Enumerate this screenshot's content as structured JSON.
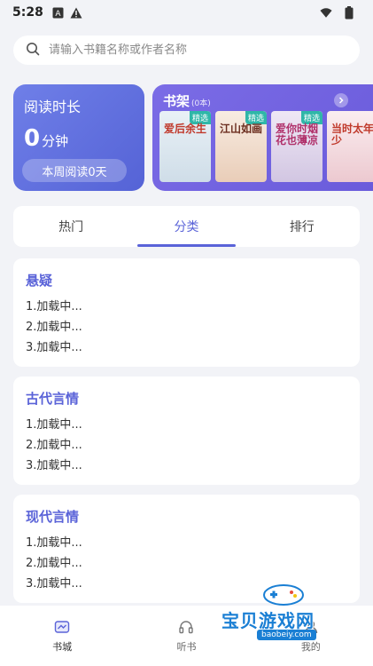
{
  "statusbar": {
    "time": "5:28"
  },
  "search": {
    "placeholder": "请输入书籍名称或作者名称"
  },
  "reading": {
    "title": "阅读时长",
    "minutes": "0",
    "unit": "分钟",
    "week_label": "本周阅读0天"
  },
  "shelf": {
    "title": "书架",
    "count": "(0本)",
    "books": [
      {
        "title": "爱后余生",
        "tag": "精选",
        "bg": "#dfe9f0"
      },
      {
        "title": "江山如画",
        "tag": "精选",
        "bg": "#f2e3d6"
      },
      {
        "title": "爱你时烟花也薄凉",
        "tag": "精选",
        "bg": "#e8e2f0"
      },
      {
        "title": "当时太年少",
        "tag": "",
        "bg": "#f5e6ea"
      }
    ]
  },
  "tabs": [
    {
      "label": "热门"
    },
    {
      "label": "分类"
    },
    {
      "label": "排行"
    }
  ],
  "categories": [
    {
      "name": "悬疑",
      "items": [
        "1.加载中...",
        "2.加载中...",
        "3.加载中..."
      ]
    },
    {
      "name": "古代言情",
      "items": [
        "1.加载中...",
        "2.加载中...",
        "3.加载中..."
      ]
    },
    {
      "name": "现代言情",
      "items": [
        "1.加载中...",
        "2.加载中...",
        "3.加载中..."
      ]
    }
  ],
  "bottomnav": [
    {
      "label": "书城",
      "icon": "bookstore-icon"
    },
    {
      "label": "听书",
      "icon": "headphones-icon"
    },
    {
      "label": "我的",
      "icon": "profile-icon"
    }
  ],
  "watermark": {
    "text": "宝贝游戏网",
    "url": "baobeiy.com"
  },
  "colors": {
    "accent": "#5a63d8",
    "card_blue": "#6f7fe8",
    "card_purple": "#7b6ce6"
  }
}
